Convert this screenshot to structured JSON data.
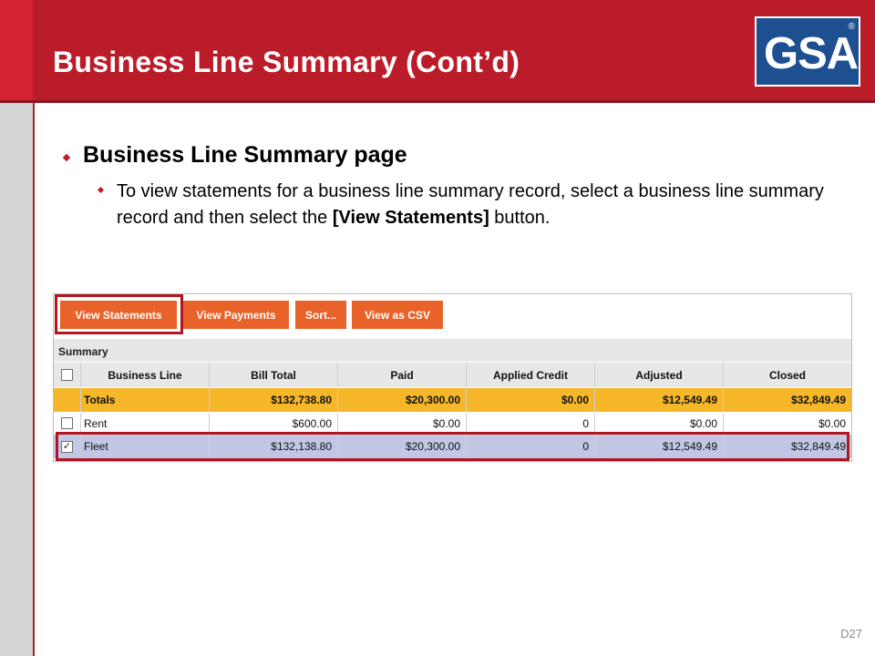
{
  "slide": {
    "title": "Business Line Summary (Cont’d)",
    "logo_text": "GSA",
    "logo_registered": "®",
    "bullet_1": "Business Line Summary page",
    "bullet_2_prefix": "To view statements for a business line summary record, select a business line summary record and then select the ",
    "bullet_2_bold": "[View Statements]",
    "bullet_2_suffix": " button.",
    "page_number": "D27",
    "colors": {
      "header_red": "#bb1c2a",
      "logo_blue": "#1d4f91",
      "button_orange": "#e8632a",
      "totals_yellow": "#f6b728",
      "selected_row": "#c1c7e4"
    }
  },
  "toolbar": {
    "view_statements": "View Statements",
    "view_payments": "View Payments",
    "sort": "Sort...",
    "view_csv": "View as CSV"
  },
  "summary": {
    "label": "Summary",
    "columns": [
      "Business Line",
      "Bill Total",
      "Paid",
      "Applied Credit",
      "Adjusted",
      "Closed"
    ],
    "rows": [
      {
        "business_line": "Totals",
        "bill_total": "$132,738.80",
        "paid": "$20,300.00",
        "applied_credit": "$0.00",
        "adjusted": "$12,549.49",
        "closed": "$32,849.49",
        "checked": false
      },
      {
        "business_line": "Rent",
        "bill_total": "$600.00",
        "paid": "$0.00",
        "applied_credit": "0",
        "adjusted": "$0.00",
        "closed": "$0.00",
        "checked": false
      },
      {
        "business_line": "Fleet",
        "bill_total": "$132,138.80",
        "paid": "$20,300.00",
        "applied_credit": "0",
        "adjusted": "$12,549.49",
        "closed": "$32,849.49",
        "checked": true,
        "check_glyph": "✓"
      }
    ]
  }
}
